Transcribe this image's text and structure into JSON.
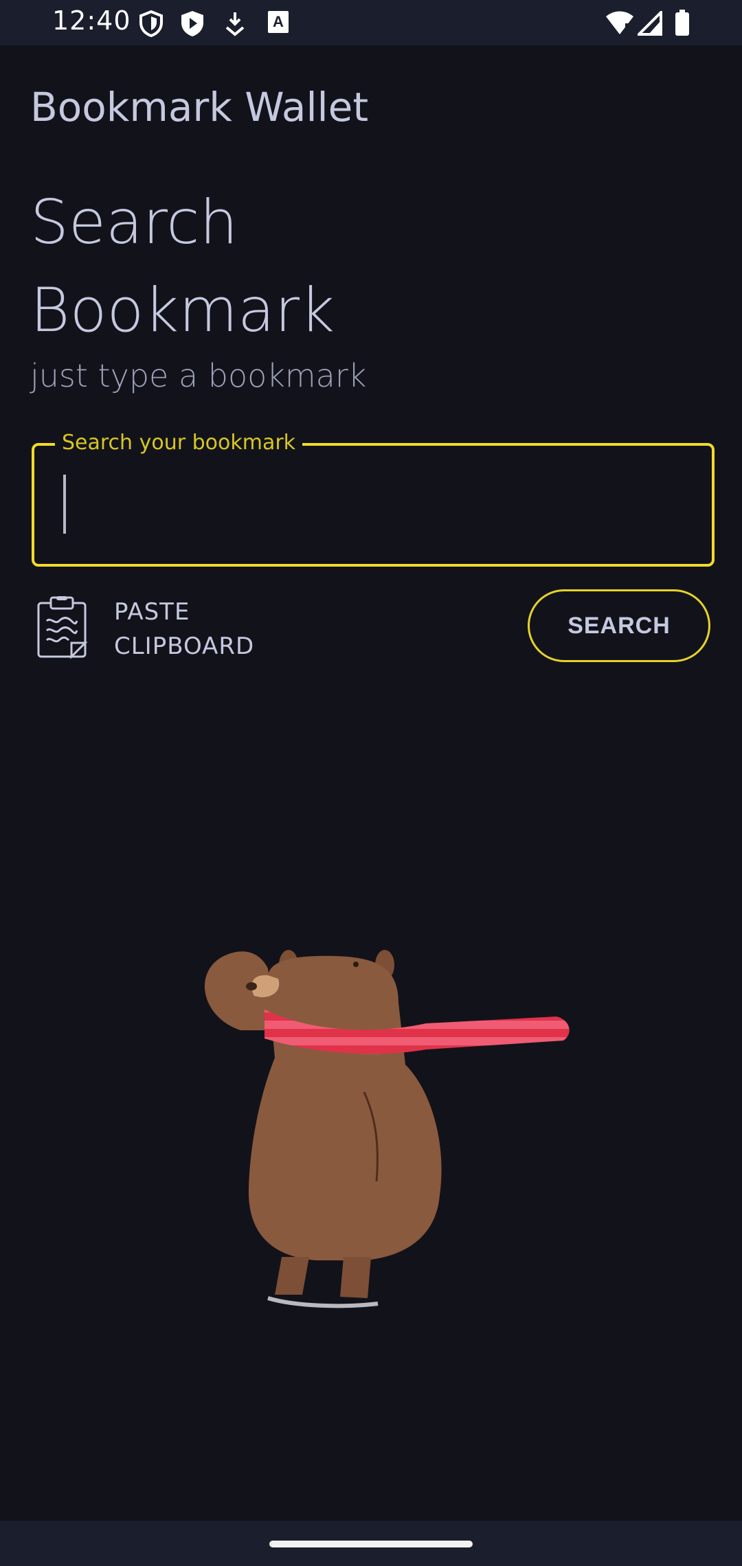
{
  "status_bar": {
    "time": "12:40",
    "left_icons": [
      "shield-icon",
      "play-protect-icon",
      "download-icon",
      "keyboard-a-icon"
    ],
    "right_icons": [
      "wifi-icon",
      "signal-icon",
      "battery-icon"
    ]
  },
  "app": {
    "title": "Bookmark Wallet"
  },
  "main": {
    "heading_line1": "Search",
    "heading_line2": "Bookmark",
    "subtitle": "just type a bookmark"
  },
  "search_field": {
    "label": "Search your bookmark",
    "value": "",
    "accent_color": "#f0dc29"
  },
  "paste": {
    "line1": "PASTE",
    "line2": "CLIPBOARD",
    "icon": "clipboard-icon"
  },
  "search_button": {
    "label": "SEARCH"
  },
  "illustration": {
    "name": "bear-with-red-scarf"
  },
  "colors": {
    "background": "#12131a",
    "text": "#c5c9e0",
    "accent": "#f0dc29",
    "scarf": "#e0334a",
    "bear": "#8a5a3e"
  }
}
